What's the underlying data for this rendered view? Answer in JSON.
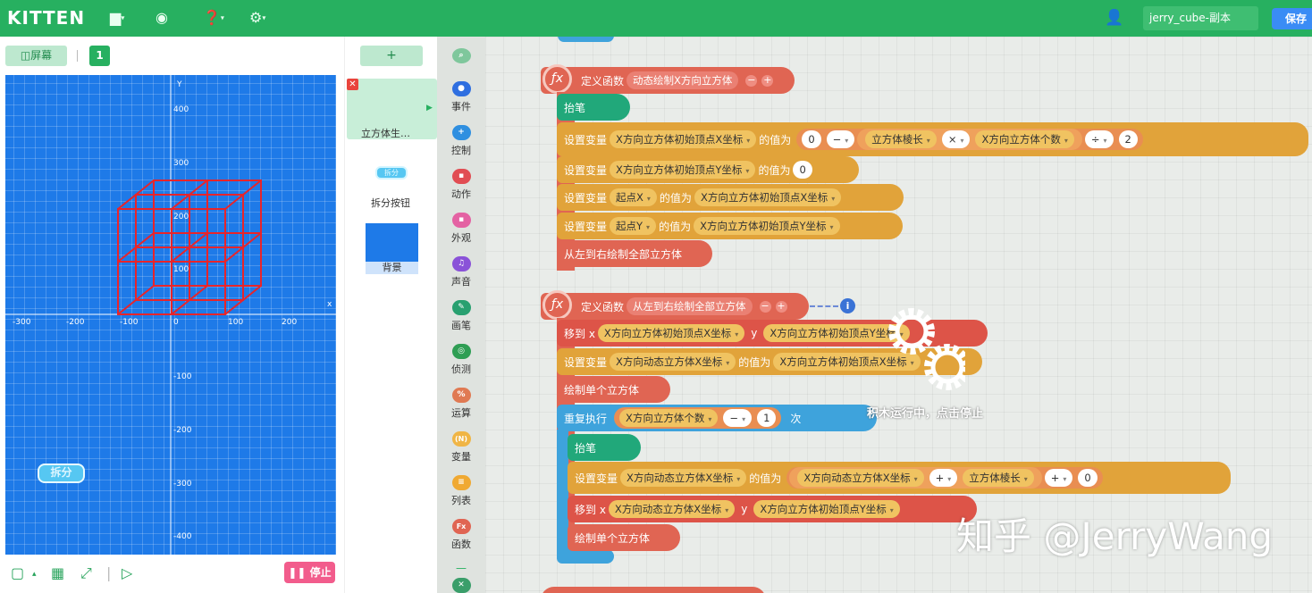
{
  "app": {
    "logo": "KITTEN",
    "project_name": "jerry_cube-副本",
    "save_label": "保存"
  },
  "stage_panel": {
    "screen_button": "屏幕",
    "scene_number": "1",
    "stop_label": "停止",
    "sprite_label": "拆分",
    "axes": {
      "x_label": "x",
      "y_label": "Y",
      "x_ticks": [
        "-300",
        "-200",
        "-100",
        "0",
        "100",
        "200"
      ],
      "y_ticks": [
        "400",
        "300",
        "200",
        "100",
        "-100",
        "-200",
        "-300",
        "-400"
      ]
    }
  },
  "sprites_panel": {
    "add_label": "+",
    "sprites": [
      {
        "name": "立方体生…",
        "selected": true
      },
      {
        "name": "拆分按钮",
        "thumb_text": "拆分"
      },
      {
        "name": "背景"
      }
    ]
  },
  "categories": [
    {
      "label": "事件",
      "color": "#2f6fe0"
    },
    {
      "label": "控制",
      "color": "#2f8fe0",
      "icon": "+"
    },
    {
      "label": "动作",
      "color": "#e14d53"
    },
    {
      "label": "外观",
      "color": "#e462a3"
    },
    {
      "label": "声音",
      "color": "#8a52d8",
      "icon": "♫"
    },
    {
      "label": "画笔",
      "color": "#28a070"
    },
    {
      "label": "侦测",
      "color": "#2f9e54"
    },
    {
      "label": "运算",
      "color": "#e07a53",
      "icon": "%"
    },
    {
      "label": "变量",
      "color": "#f0b545",
      "icon": "(N)"
    },
    {
      "label": "列表",
      "color": "#f0a932",
      "icon": "≡"
    },
    {
      "label": "函数",
      "color": "#e06553",
      "icon": "Fx"
    }
  ],
  "code": {
    "fn1": {
      "define": "定义函数",
      "name": "动态绘制X方向立方体",
      "pen_up": "抬笔",
      "set1": {
        "label": "设置变量",
        "var": "X方向立方体初始顶点X坐标",
        "to": "的值为",
        "a": "0",
        "op1": "−",
        "b": "立方体棱长",
        "op2": "×",
        "c": "X方向立方体个数",
        "op3": "÷",
        "d": "2"
      },
      "set2": {
        "label": "设置变量",
        "var": "X方向立方体初始顶点Y坐标",
        "to": "的值为",
        "val": "0"
      },
      "set3": {
        "label": "设置变量",
        "var": "起点X",
        "to": "的值为",
        "val": "X方向立方体初始顶点X坐标"
      },
      "set4": {
        "label": "设置变量",
        "var": "起点Y",
        "to": "的值为",
        "val": "X方向立方体初始顶点Y坐标"
      },
      "call": "从左到右绘制全部立方体"
    },
    "fn2": {
      "define": "定义函数",
      "name": "从左到右绘制全部立方体",
      "move": {
        "label": "移到 x",
        "x": "X方向立方体初始顶点X坐标",
        "y_label": "y",
        "y": "X方向立方体初始顶点Y坐标"
      },
      "set": {
        "label": "设置变量",
        "var": "X方向动态立方体X坐标",
        "to": "的值为",
        "val": "X方向立方体初始顶点X坐标"
      },
      "call": "绘制单个立方体",
      "repeat": {
        "label": "重复执行",
        "a": "X方向立方体个数",
        "op": "−",
        "b": "1",
        "times": "次"
      },
      "inner_pen_up": "抬笔",
      "inner_set": {
        "label": "设置变量",
        "var": "X方向动态立方体X坐标",
        "to": "的值为",
        "a": "X方向动态立方体X坐标",
        "op1": "+",
        "b": "立方体棱长",
        "op2": "+",
        "c": "0"
      },
      "inner_move": {
        "label": "移到 x",
        "x": "X方向动态立方体X坐标",
        "y_label": "y",
        "y": "X方向立方体初始顶点Y坐标"
      },
      "inner_call": "绘制单个立方体"
    }
  },
  "status": "积木运行中，点击停止",
  "watermark": "知乎 @JerryWang"
}
